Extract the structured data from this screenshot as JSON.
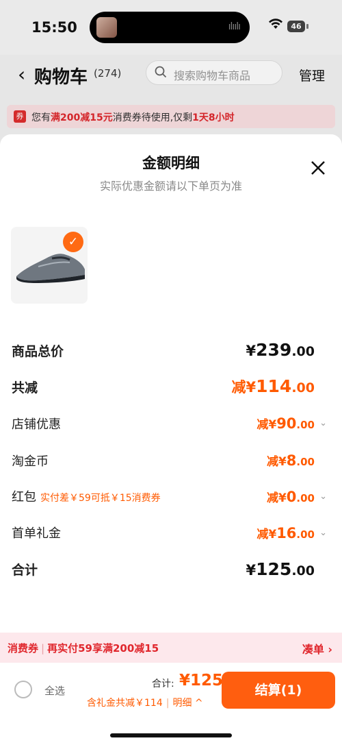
{
  "status": {
    "time": "15:50",
    "battery": "46"
  },
  "header": {
    "title": "购物车",
    "count": "(274)",
    "search_placeholder": "搜索购物车商品",
    "manage": "管理"
  },
  "banner": {
    "p1": "您有",
    "p2": "满200减15元",
    "p3": "消费券待使用,仅剩",
    "p4": "1天8小时"
  },
  "sheet": {
    "title": "金额明细",
    "subtitle": "实际优惠金额请以下单页为准",
    "rows": [
      {
        "label": "商品总价",
        "prefix": "¥",
        "int": "239",
        "dec": ".00"
      },
      {
        "label": "共减",
        "prefix": "减¥",
        "int": "114",
        "dec": ".00"
      },
      {
        "label": "店铺优惠",
        "prefix": "减¥",
        "int": "90",
        "dec": ".00"
      },
      {
        "label": "淘金币",
        "prefix": "减¥",
        "int": "8",
        "dec": ".00"
      },
      {
        "label": "红包",
        "note": "实付差￥59可抵￥15消费券",
        "prefix": "减¥",
        "int": "0",
        "dec": ".00"
      },
      {
        "label": "首单礼金",
        "prefix": "减¥",
        "int": "16",
        "dec": ".00"
      },
      {
        "label": "合计",
        "prefix": "¥",
        "int": "125",
        "dec": ".00"
      }
    ]
  },
  "coupon_bar": {
    "tag": "消费券",
    "text": "再实付59享满200减15",
    "link": "凑单"
  },
  "bottom": {
    "select_all": "全选",
    "total_label": "合计:",
    "total_value": "¥125",
    "discount_text": "含礼金共减￥114",
    "detail_link": "明细",
    "checkout": "结算(1)"
  },
  "colors": {
    "accent": "#ff5a00",
    "red": "#e0272d",
    "checkout_bg": "#ff5e0f"
  }
}
